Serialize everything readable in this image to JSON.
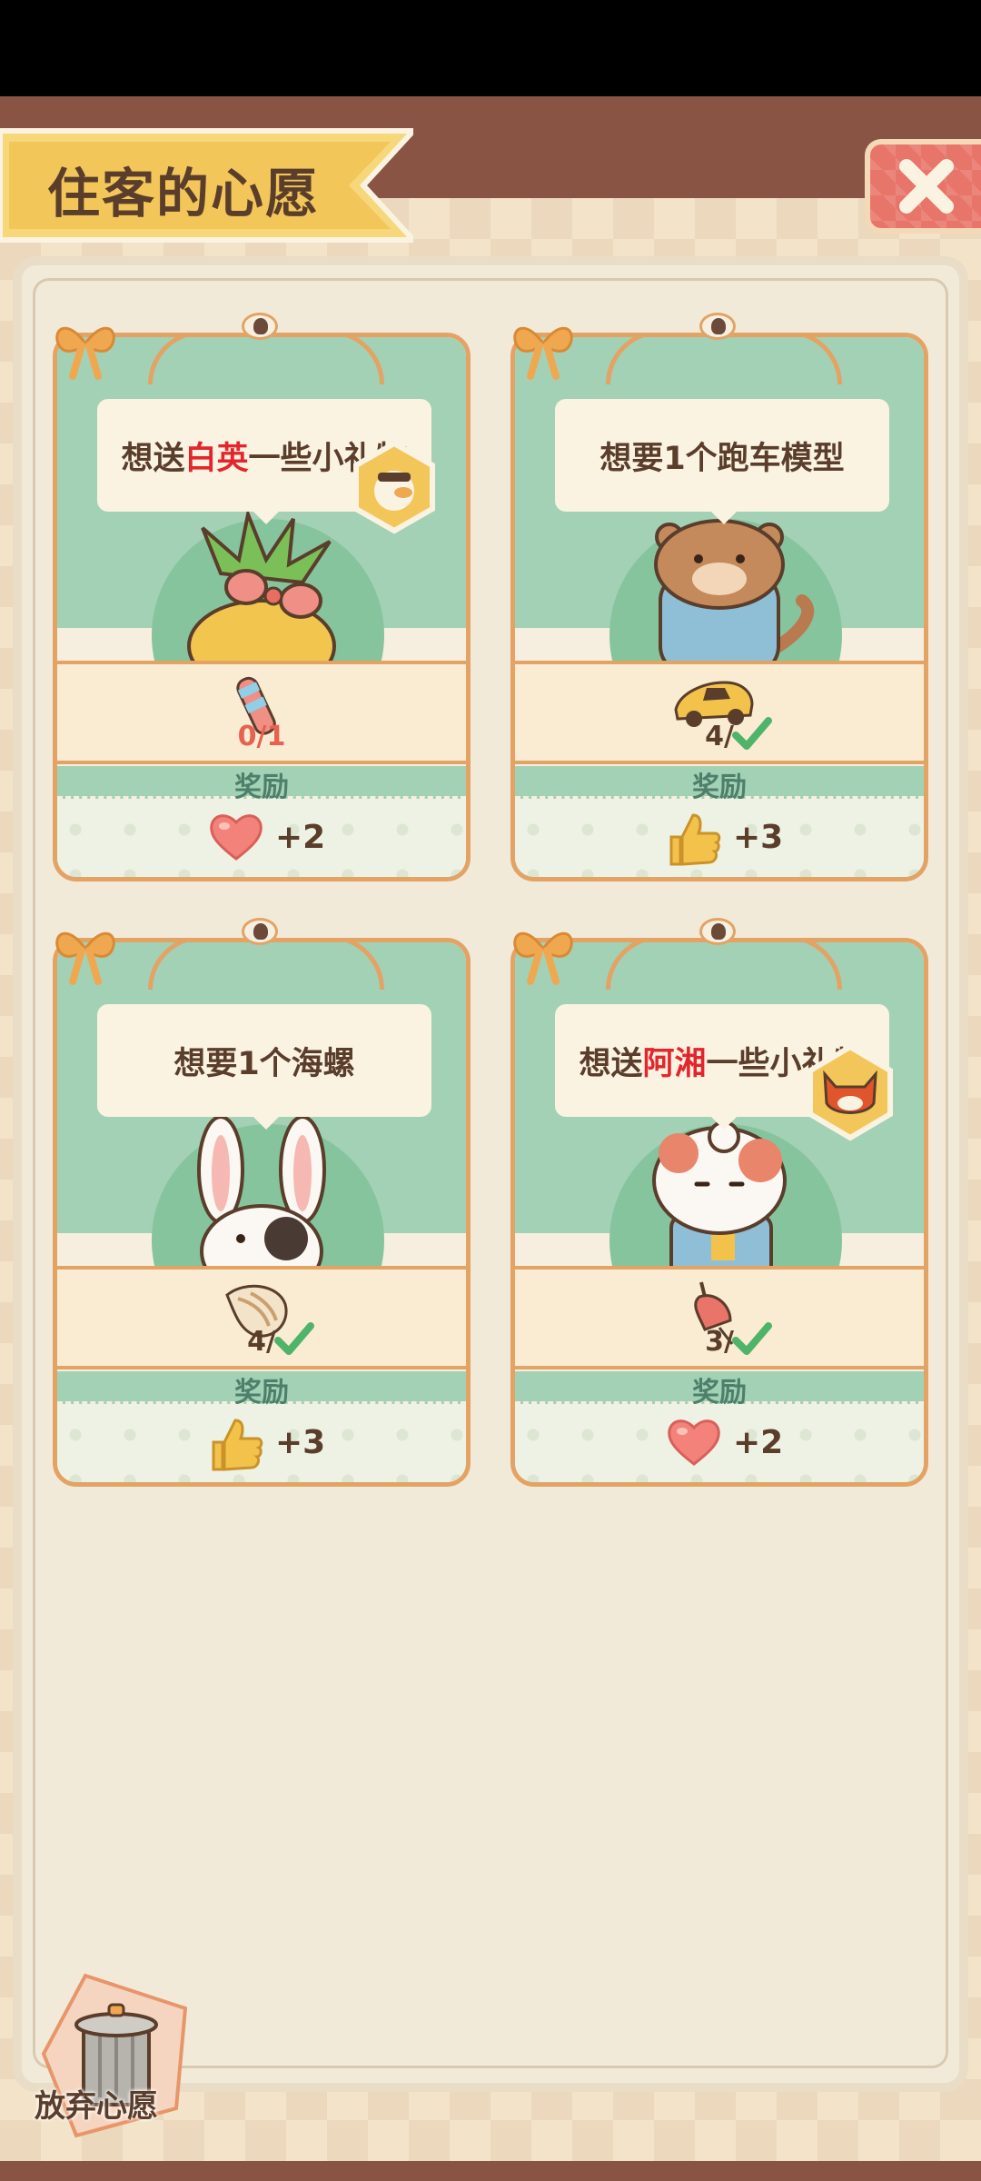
{
  "header": {
    "title": "住客的心愿"
  },
  "close": {
    "icon": "close-x-icon"
  },
  "wishes": [
    {
      "text_before": "想送",
      "highlight": "白英",
      "text_after": "一些小礼物",
      "item_icon": "candy-stick-icon",
      "count": "0/1",
      "reward_label": "奖励",
      "reward_icon": "heart-icon",
      "reward_value": "+2",
      "badge_icon": "duck-portrait-icon"
    },
    {
      "text_before": "想要1个跑车模型",
      "highlight": "",
      "text_after": "",
      "item_icon": "race-car-model-icon",
      "count": "4/",
      "reward_label": "奖励",
      "reward_icon": "thumbs-up-icon",
      "reward_value": "+3"
    },
    {
      "text_before": "想要1个海螺",
      "highlight": "",
      "text_after": "",
      "item_icon": "conch-shell-icon",
      "count": "4/",
      "reward_label": "奖励",
      "reward_icon": "thumbs-up-icon",
      "reward_value": "+3"
    },
    {
      "text_before": "想送",
      "highlight": "阿湘",
      "text_after": "一些小礼物",
      "item_icon": "chime-icon",
      "count": "3/",
      "reward_label": "奖励",
      "reward_icon": "heart-icon",
      "reward_value": "+2",
      "badge_icon": "fox-portrait-icon"
    }
  ],
  "discard": {
    "label": "放弃心愿",
    "icon": "trash-can-icon"
  },
  "colors": {
    "highlight": "#e4262c",
    "card_border": "#e3a364",
    "scene_green": "#a3d1b5",
    "header_brown": "#8a5444"
  }
}
